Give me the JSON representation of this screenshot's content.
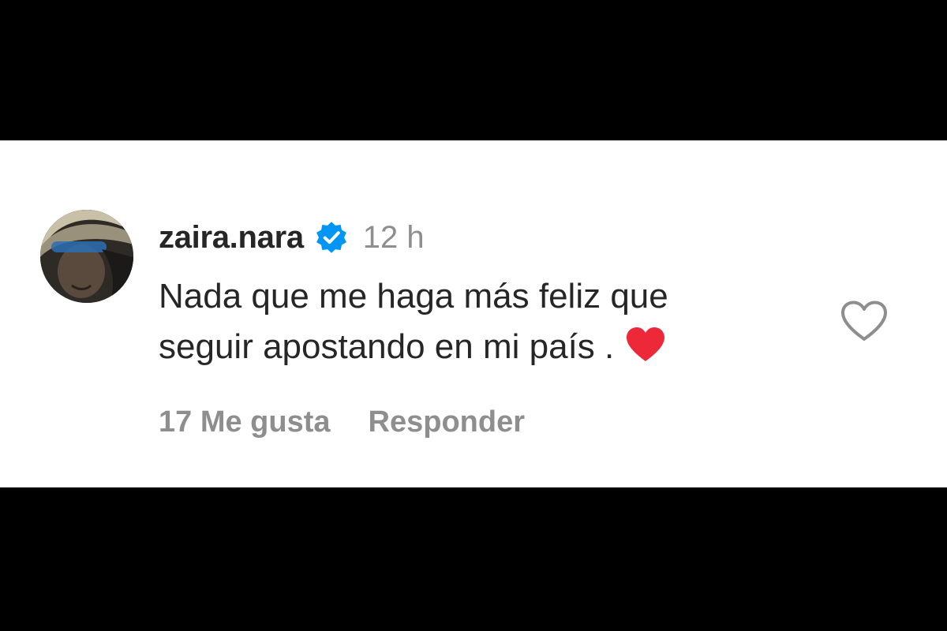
{
  "comment": {
    "username": "zaira.nara",
    "verified_icon": "verified-badge-icon",
    "timestamp": "12 h",
    "text_line_1": "Nada que me haga más feliz que",
    "text_line_2": "seguir apostando en mi país .",
    "emoji": "red-heart-emoji",
    "likes_label": "17 Me gusta",
    "reply_label": "Responder",
    "like_icon": "heart-outline-icon"
  },
  "colors": {
    "background_letterbox": "#000000",
    "card_background": "#ffffff",
    "primary_text": "#262626",
    "secondary_text": "#8e8e8e",
    "verified_blue": "#0095f6",
    "heart_red": "#ed2939"
  }
}
